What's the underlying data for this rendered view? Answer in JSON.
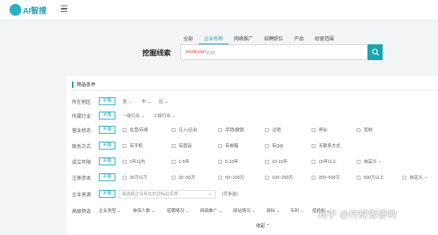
{
  "app": {
    "logo_text": "AI智搜"
  },
  "tabs": [
    "全部",
    "企业名称",
    "网络推广",
    "招聘职位",
    "产品",
    "经营范围"
  ],
  "search": {
    "title": "挖掘线索",
    "typed": "wenkulan",
    "placeholder": "名称"
  },
  "filters": {
    "title": "筛选条件",
    "unlimited": "不限",
    "region": {
      "label": "所在地区",
      "dropdowns": [
        "省",
        "市",
        "区"
      ]
    },
    "industry": {
      "label": "所属行业",
      "dropdowns": [
        "一级行业",
        "二级行业"
      ]
    },
    "status": {
      "label": "营业状态",
      "options": [
        "在营/存续",
        "迁入/迁出",
        "吊销/撤销",
        "注销",
        "停业",
        "其他"
      ]
    },
    "contact": {
      "label": "联系方式",
      "options": [
        "有手机",
        "有固话",
        "有邮箱",
        "有QQ",
        "无联系方式"
      ]
    },
    "established": {
      "label": "成立年限",
      "options": [
        "1年以内",
        "1-5年",
        "5-10年",
        "10-15年",
        "15年以上"
      ],
      "custom": "自定义"
    },
    "capital": {
      "label": "注册资本",
      "options": [
        "20万以下",
        "20~50万",
        "50~100万",
        "100~200万",
        "200~500万",
        "500万以上"
      ],
      "custom": "自定义"
    },
    "source": {
      "label": "企业来源",
      "placeholder": "请选择企业所在的目标站名称",
      "note": "（可多选）"
    },
    "advanced": {
      "label": "高级筛选",
      "items": [
        "企业类型",
        "参保人数",
        "招聘情况",
        "网络推广",
        "网站情况",
        "商标",
        "专利",
        "招投标"
      ]
    },
    "collapse": "收起"
  },
  "watermark": "知乎 @柠檬雪碧哟",
  "colors": {
    "accent": "#1ba3b3"
  }
}
